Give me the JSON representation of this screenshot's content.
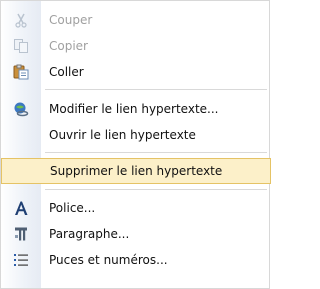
{
  "menu": {
    "items": [
      {
        "label": "Couper",
        "icon": "scissors-icon",
        "enabled": false
      },
      {
        "label": "Copier",
        "icon": "copy-icon",
        "enabled": false
      },
      {
        "label": "Coller",
        "icon": "paste-icon",
        "enabled": true
      },
      {
        "label": "Modifier le lien hypertexte...",
        "icon": "edit-hyperlink-icon",
        "enabled": true
      },
      {
        "label": "Ouvrir le lien hypertexte",
        "icon": "",
        "enabled": true
      },
      {
        "label": "Supprimer le lien hypertexte",
        "icon": "",
        "enabled": true,
        "highlighted": true
      },
      {
        "label": "Police...",
        "icon": "font-icon",
        "enabled": true
      },
      {
        "label": "Paragraphe...",
        "icon": "paragraph-icon",
        "enabled": true
      },
      {
        "label": "Puces et numéros...",
        "icon": "bullets-icon",
        "enabled": true
      }
    ]
  },
  "colors": {
    "highlight_bg": "#fcf0c9",
    "highlight_border": "#e5c365",
    "disabled_text": "#a0a0a0"
  }
}
